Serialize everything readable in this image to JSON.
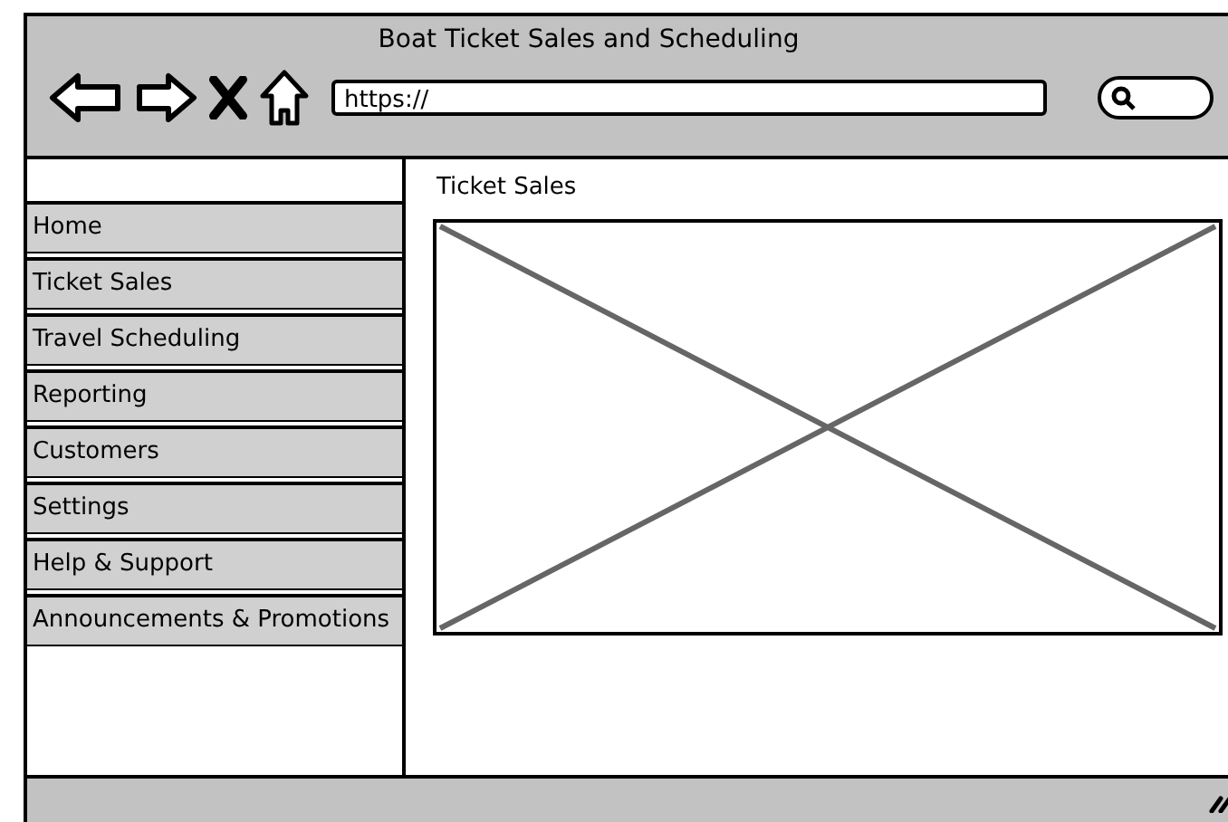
{
  "window": {
    "title": "Boat Ticket Sales and Scheduling"
  },
  "address_bar": {
    "value": "https://"
  },
  "sidebar": {
    "items": [
      {
        "label": "Home"
      },
      {
        "label": "Ticket Sales"
      },
      {
        "label": "Travel Scheduling"
      },
      {
        "label": "Reporting"
      },
      {
        "label": "Customers"
      },
      {
        "label": "Settings"
      },
      {
        "label": "Help & Support"
      },
      {
        "label": "Announcements & Promotions"
      }
    ]
  },
  "content": {
    "heading": "Ticket Sales"
  }
}
